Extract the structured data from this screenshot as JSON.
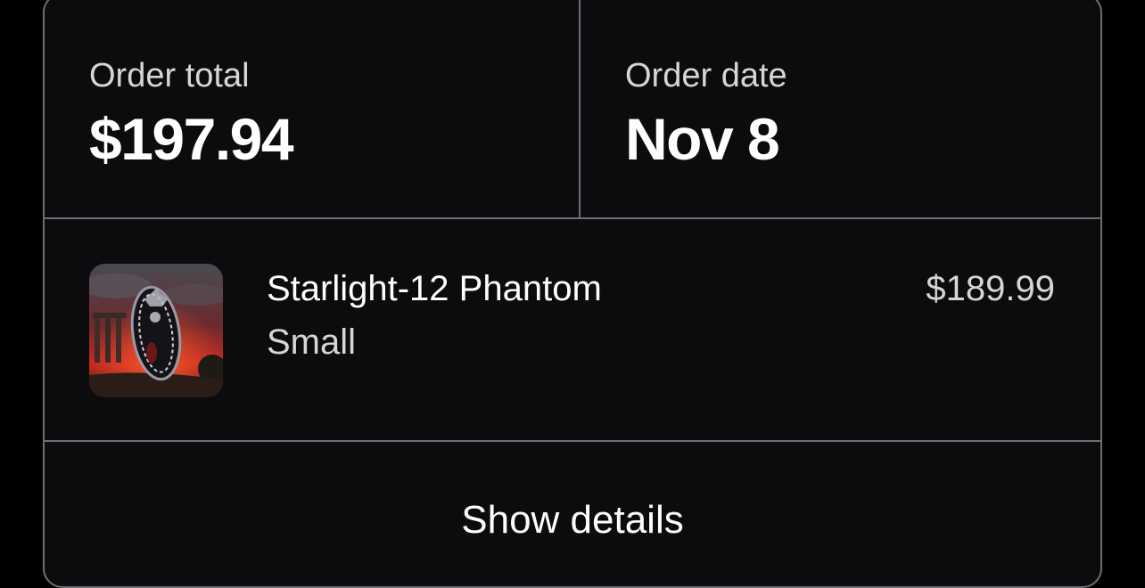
{
  "order_summary": {
    "total_label": "Order total",
    "total_value": "$197.94",
    "date_label": "Order date",
    "date_value": "Nov 8"
  },
  "item": {
    "name": "Starlight-12 Phantom",
    "variant": "Small",
    "price": "$189.99",
    "thumbnail": "product-thumbnail-image"
  },
  "actions": {
    "show_details_label": "Show details"
  },
  "colors": {
    "background": "#000000",
    "card": "#0c0c0e",
    "divider": "#6e6e73",
    "primary_text": "#ffffff",
    "secondary_text": "#d6d6d8"
  }
}
